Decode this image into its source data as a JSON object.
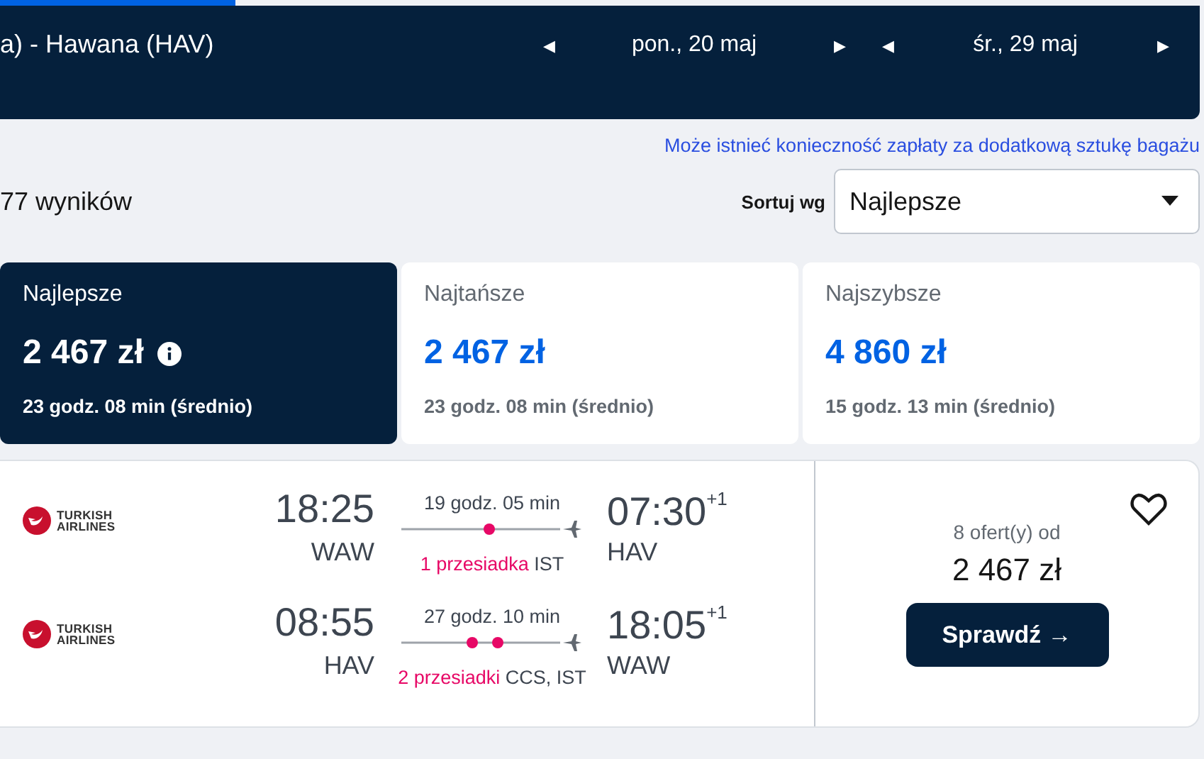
{
  "progress": {
    "level": 0.195
  },
  "header": {
    "route": "a) - Hawana (HAV)",
    "dates": [
      {
        "prev": "◀",
        "label": "pon., 20 maj",
        "next": "▶"
      },
      {
        "prev": "◀",
        "label": "śr., 29 maj",
        "next": "▶"
      }
    ]
  },
  "baggage_notice": "Może istnieć konieczność zapłaty za dodatkową sztukę bagażu",
  "results_count": "77 wyników",
  "sort": {
    "label": "Sortuj wg",
    "value": "Najlepsze"
  },
  "sort_tabs": [
    {
      "title": "Najlepsze",
      "price": "2 467 zł",
      "duration": "23 godz. 08 min (średnio)",
      "selected": true
    },
    {
      "title": "Najtańsze",
      "price": "2 467 zł",
      "duration": "23 godz. 08 min (średnio)",
      "selected": false
    },
    {
      "title": "Najszybsze",
      "price": "4 860 zł",
      "duration": "15 godz. 13 min (średnio)",
      "selected": false
    }
  ],
  "flight": {
    "legs": [
      {
        "airline": [
          "TURKISH",
          "AIRLINES"
        ],
        "depart_time": "18:25",
        "depart_airport": "WAW",
        "duration": "19 godz. 05 min",
        "stops_label": "1 przesiadka",
        "stops": [
          "IST"
        ],
        "arrive_time": "07:30",
        "day_offset": "+1",
        "arrive_airport": "HAV"
      },
      {
        "airline": [
          "TURKISH",
          "AIRLINES"
        ],
        "depart_time": "08:55",
        "depart_airport": "HAV",
        "duration": "27 godz. 10 min",
        "stops_label": "2 przesiadki",
        "stops": [
          "CCS,",
          "IST"
        ],
        "arrive_time": "18:05",
        "day_offset": "+1",
        "arrive_airport": "WAW"
      }
    ],
    "offers": "8 ofert(y) od",
    "price": "2 467 zł",
    "button": "Sprawdź",
    "button_icon": "→"
  }
}
